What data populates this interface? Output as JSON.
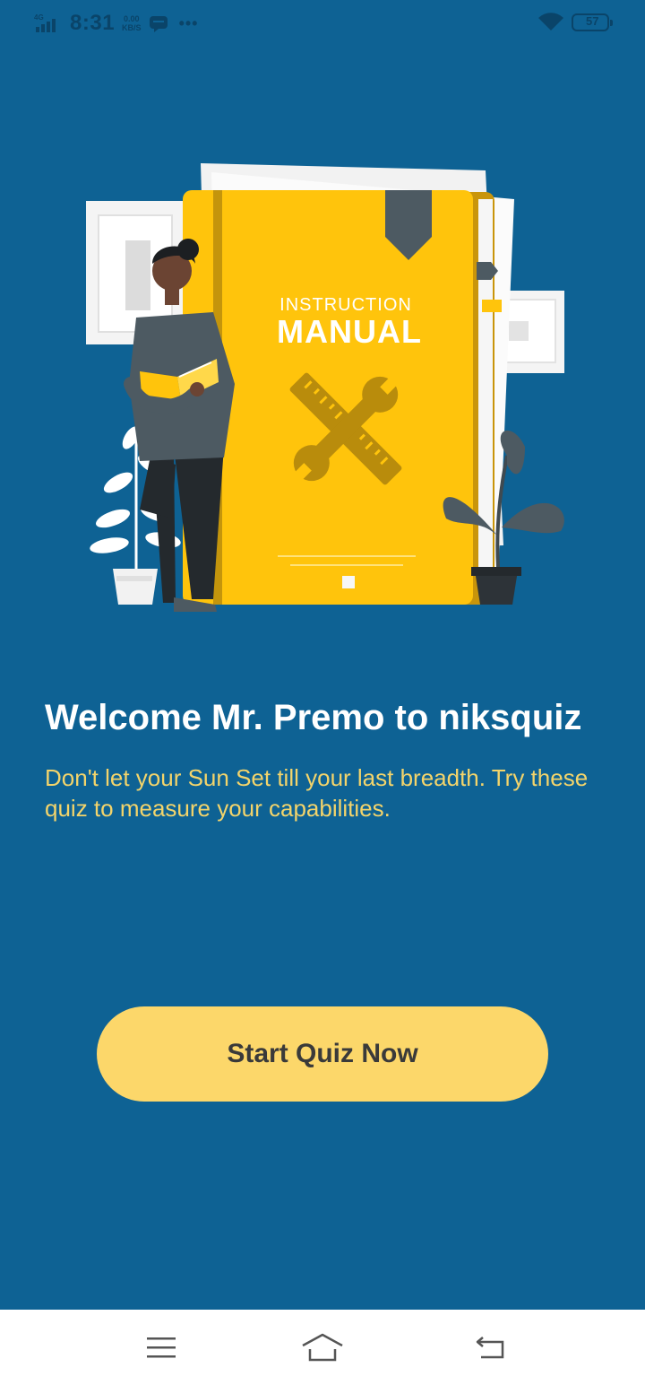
{
  "status_bar": {
    "network": "4G",
    "time": "8:31",
    "speed_value": "0.00",
    "speed_unit": "KB/S",
    "more": "•••",
    "battery": "57",
    "icons": [
      "signal-icon",
      "message-icon",
      "wifi-icon",
      "battery-icon"
    ]
  },
  "illustration": {
    "book_title_small": "INSTRUCTION",
    "book_title_large": "MANUAL",
    "icon": "tools-icon"
  },
  "welcome": {
    "title": "Welcome Mr. Premo to niksquiz",
    "subtitle": "Don't let your Sun Set till your last breadth. Try these quiz to measure your capabilities."
  },
  "start_button": {
    "label": "Start Quiz Now"
  },
  "nav_bar": {
    "items": [
      "menu-icon",
      "home-icon",
      "back-icon"
    ]
  },
  "colors": {
    "background": "#0e6294",
    "accent_yellow": "#fcd76a",
    "subtitle_yellow": "#f3d46b",
    "book_yellow": "#ffc40c"
  }
}
